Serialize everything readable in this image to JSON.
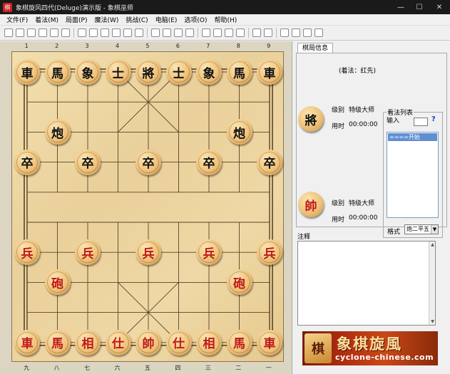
{
  "window": {
    "title": "象棋旋风四代(Deluge)演示版 - 象棋巫师",
    "app_icon": "棋"
  },
  "menu": [
    "文件(F)",
    "着法(M)",
    "局面(P)",
    "魔法(W)",
    "挑战(C)",
    "电脑(E)",
    "选项(O)",
    "帮助(H)"
  ],
  "toolbar_icons": [
    "new-file-icon",
    "open-file-icon",
    "save-icon",
    "print-icon",
    "copy-icon",
    "paste-icon",
    "first-move-icon",
    "prev-move-icon",
    "next-move-icon",
    "last-move-icon",
    "delete-move-icon",
    "board-setup-icon",
    "flip-board-icon",
    "edit-icon",
    "palette-icon",
    "color-icon",
    "analyze-icon",
    "record-icon",
    "stop-icon",
    "sound-icon",
    "book-icon",
    "clock-icon",
    "settings-icon",
    "image-icon",
    "chart-icon",
    "exit-icon"
  ],
  "board": {
    "files_top": [
      "1",
      "2",
      "3",
      "4",
      "5",
      "6",
      "7",
      "8",
      "9"
    ],
    "files_bottom": [
      "九",
      "八",
      "七",
      "六",
      "五",
      "四",
      "三",
      "二",
      "一"
    ],
    "colors": {
      "black": "#111111",
      "red": "#c01818"
    },
    "pieces": [
      {
        "c": 0,
        "r": 0,
        "t": "車",
        "side": "black"
      },
      {
        "c": 1,
        "r": 0,
        "t": "馬",
        "side": "black"
      },
      {
        "c": 2,
        "r": 0,
        "t": "象",
        "side": "black"
      },
      {
        "c": 3,
        "r": 0,
        "t": "士",
        "side": "black"
      },
      {
        "c": 4,
        "r": 0,
        "t": "將",
        "side": "black"
      },
      {
        "c": 5,
        "r": 0,
        "t": "士",
        "side": "black"
      },
      {
        "c": 6,
        "r": 0,
        "t": "象",
        "side": "black"
      },
      {
        "c": 7,
        "r": 0,
        "t": "馬",
        "side": "black"
      },
      {
        "c": 8,
        "r": 0,
        "t": "車",
        "side": "black"
      },
      {
        "c": 1,
        "r": 2,
        "t": "炮",
        "side": "black"
      },
      {
        "c": 7,
        "r": 2,
        "t": "炮",
        "side": "black"
      },
      {
        "c": 0,
        "r": 3,
        "t": "卒",
        "side": "black"
      },
      {
        "c": 2,
        "r": 3,
        "t": "卒",
        "side": "black"
      },
      {
        "c": 4,
        "r": 3,
        "t": "卒",
        "side": "black"
      },
      {
        "c": 6,
        "r": 3,
        "t": "卒",
        "side": "black"
      },
      {
        "c": 8,
        "r": 3,
        "t": "卒",
        "side": "black"
      },
      {
        "c": 0,
        "r": 6,
        "t": "兵",
        "side": "red"
      },
      {
        "c": 2,
        "r": 6,
        "t": "兵",
        "side": "red"
      },
      {
        "c": 4,
        "r": 6,
        "t": "兵",
        "side": "red"
      },
      {
        "c": 6,
        "r": 6,
        "t": "兵",
        "side": "red"
      },
      {
        "c": 8,
        "r": 6,
        "t": "兵",
        "side": "red"
      },
      {
        "c": 1,
        "r": 7,
        "t": "砲",
        "side": "red"
      },
      {
        "c": 7,
        "r": 7,
        "t": "砲",
        "side": "red"
      },
      {
        "c": 0,
        "r": 9,
        "t": "車",
        "side": "red"
      },
      {
        "c": 1,
        "r": 9,
        "t": "馬",
        "side": "red"
      },
      {
        "c": 2,
        "r": 9,
        "t": "相",
        "side": "red"
      },
      {
        "c": 3,
        "r": 9,
        "t": "仕",
        "side": "red"
      },
      {
        "c": 4,
        "r": 9,
        "t": "帥",
        "side": "red"
      },
      {
        "c": 5,
        "r": 9,
        "t": "仕",
        "side": "red"
      },
      {
        "c": 6,
        "r": 9,
        "t": "相",
        "side": "red"
      },
      {
        "c": 7,
        "r": 9,
        "t": "馬",
        "side": "red"
      },
      {
        "c": 8,
        "r": 9,
        "t": "車",
        "side": "red"
      }
    ]
  },
  "panel": {
    "tab": "棋局信息",
    "move_header": "(着法：红先)",
    "black_player": {
      "avatar": "將",
      "level_label": "级别",
      "level": "特级大师",
      "time_label": "用时",
      "time": "00:00:00"
    },
    "red_player": {
      "avatar": "帥",
      "level_label": "级别",
      "level": "特级大师",
      "time_label": "用时",
      "time": "00:00:00"
    },
    "move_list": {
      "group_label": "看法列表",
      "input_label": "输入",
      "help": "?",
      "selected": "====开始===="
    },
    "format": {
      "label": "格式",
      "value": "炮二平五"
    },
    "notes_label": "注释",
    "banner": {
      "logo": "棋",
      "title": "象棋旋風",
      "url": "cyclone-chinese.com"
    }
  }
}
